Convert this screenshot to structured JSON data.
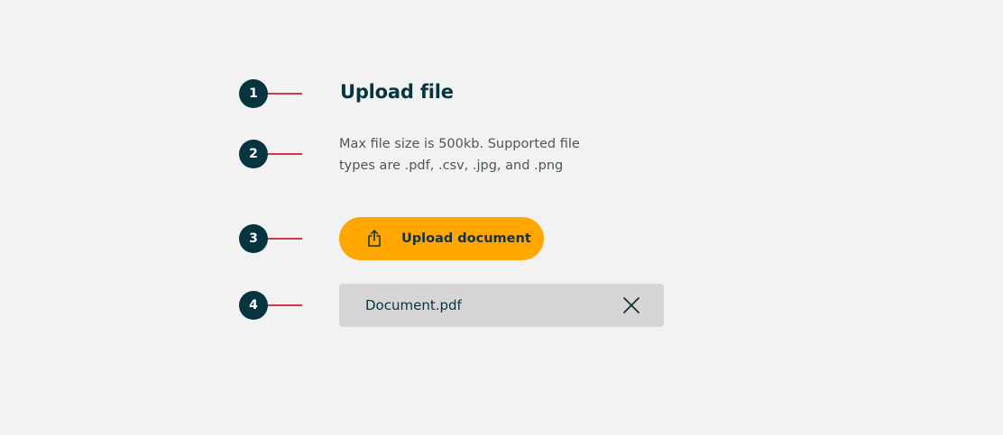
{
  "markers": [
    "1",
    "2",
    "3",
    "4"
  ],
  "title": "Upload file",
  "description": "Max file size is 500kb. Supported file types are .pdf, .csv, .jpg, and .png",
  "upload_button": {
    "label": "Upload document",
    "icon": "upload-share-icon"
  },
  "file": {
    "name": "Document.pdf",
    "remove_icon": "close-icon"
  },
  "colors": {
    "background": "#f2f2f2",
    "marker": "#063540",
    "leader": "#d6354b",
    "primary_button": "#ffa600",
    "file_chip": "#d6d6d6",
    "heading_text": "#063540",
    "body_text": "#4e5659"
  }
}
